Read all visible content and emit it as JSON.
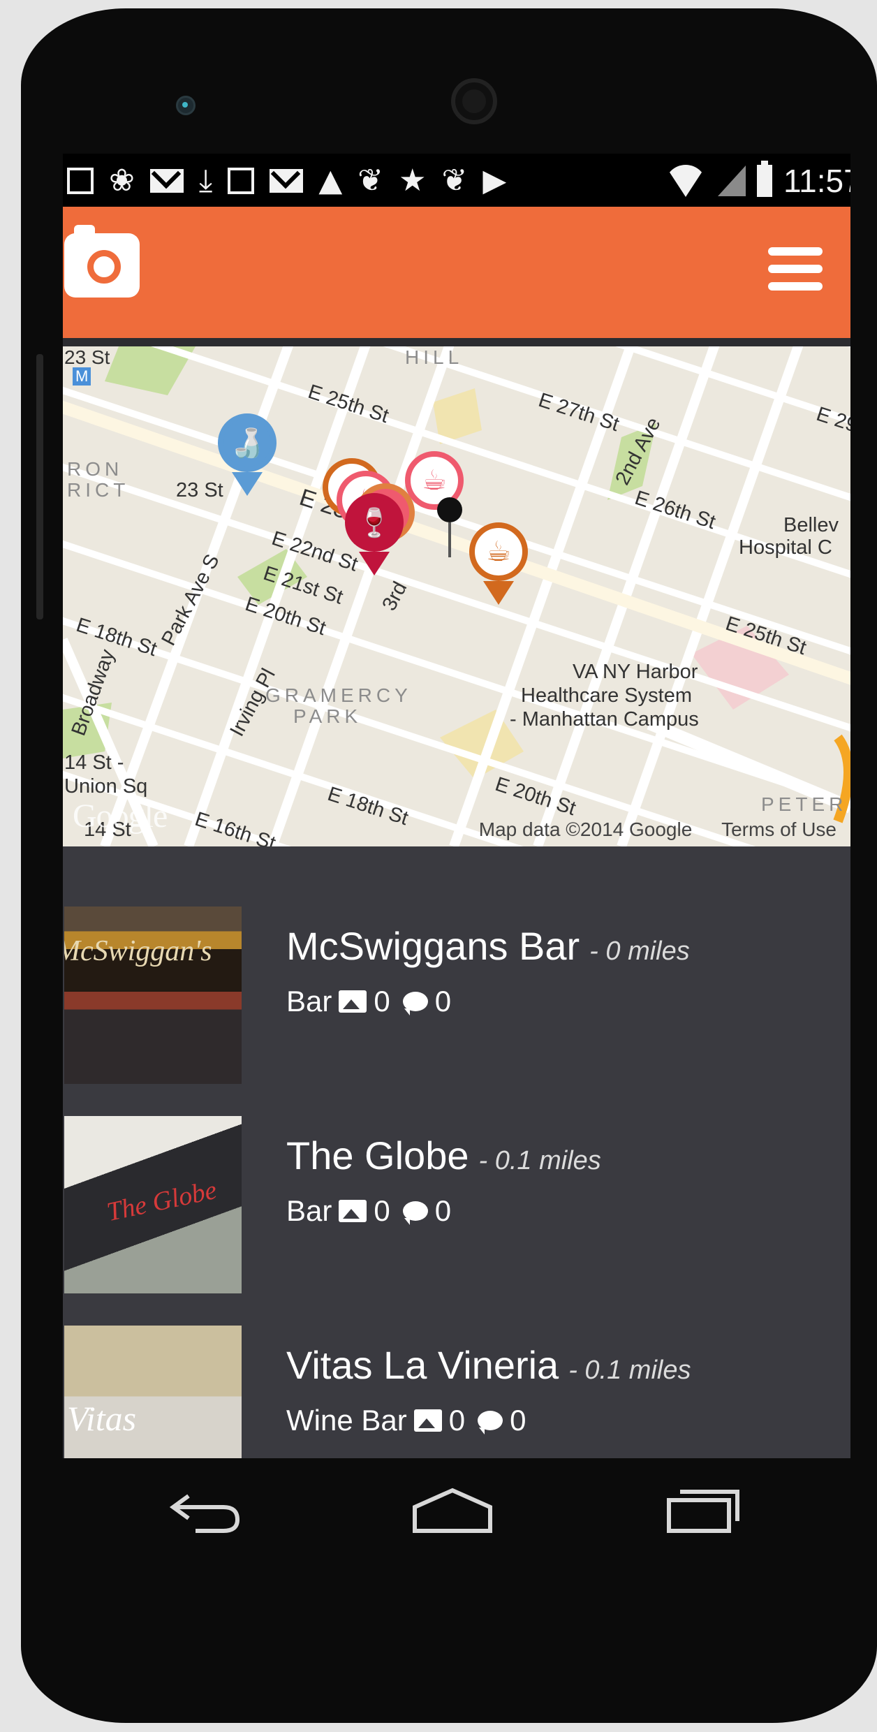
{
  "status_bar": {
    "time": "11:57",
    "icons": [
      "plus-box-icon",
      "link-icon",
      "mail-icon",
      "download-icon",
      "image-icon",
      "mail-icon",
      "warning-icon",
      "twitter-icon",
      "star-icon",
      "twitter-icon",
      "youtube-icon"
    ]
  },
  "header": {
    "left_icon": "camera-icon",
    "right_icon": "hamburger-menu-icon",
    "accent": "#ef6c3b"
  },
  "map": {
    "labels": {
      "st23_top": "23 St",
      "hill": "HILL",
      "e25": "E 25th St",
      "e27": "E 27th St",
      "second_ave": "2nd Ave",
      "e29": "E 29",
      "iron": "RON",
      "rict": "RICT",
      "st23": "23 St",
      "e23": "E 23rd St",
      "park_ave": "Park Ave S",
      "e22": "E 22nd St",
      "e26": "E 26th St",
      "bellev": "Bellev",
      "hospital": "Hospital C",
      "broadway": "Broadway",
      "e21": "E 21st St",
      "e20": "E 20th St",
      "e18": "E 18th St",
      "irving": "Irving Pl",
      "gramercy": "GRAMERCY",
      "park": "PARK",
      "e25b": "E 25th St",
      "va1": "VA NY Harbor",
      "va2": "Healthcare System",
      "va3": "- Manhattan Campus",
      "st14a": "14 St -",
      "st14b": "Union Sq",
      "e18b": "E 18th St",
      "e20b": "E 20th St",
      "e16": "E 16th St",
      "st14c": "14 St",
      "ave3": "3rd",
      "peter": "PETER",
      "google": "Google",
      "map_data": "Map data ©2014 Google",
      "terms": "Terms of Use"
    }
  },
  "venues": [
    {
      "name": "McSwiggans Bar",
      "distance": "- 0 miles",
      "type": "Bar",
      "photos": "0",
      "comments": "0",
      "sign": "McSwiggan's"
    },
    {
      "name": "The Globe",
      "distance": "- 0.1 miles",
      "type": "Bar",
      "photos": "0",
      "comments": "0",
      "sign": "The Globe"
    },
    {
      "name": "Vitas La Vineria",
      "distance": "- 0.1 miles",
      "type": "Wine Bar",
      "photos": "0",
      "comments": "0",
      "sign": "Vitas"
    }
  ],
  "nav": {
    "back": "back-icon",
    "home": "home-icon",
    "recents": "recents-icon"
  }
}
